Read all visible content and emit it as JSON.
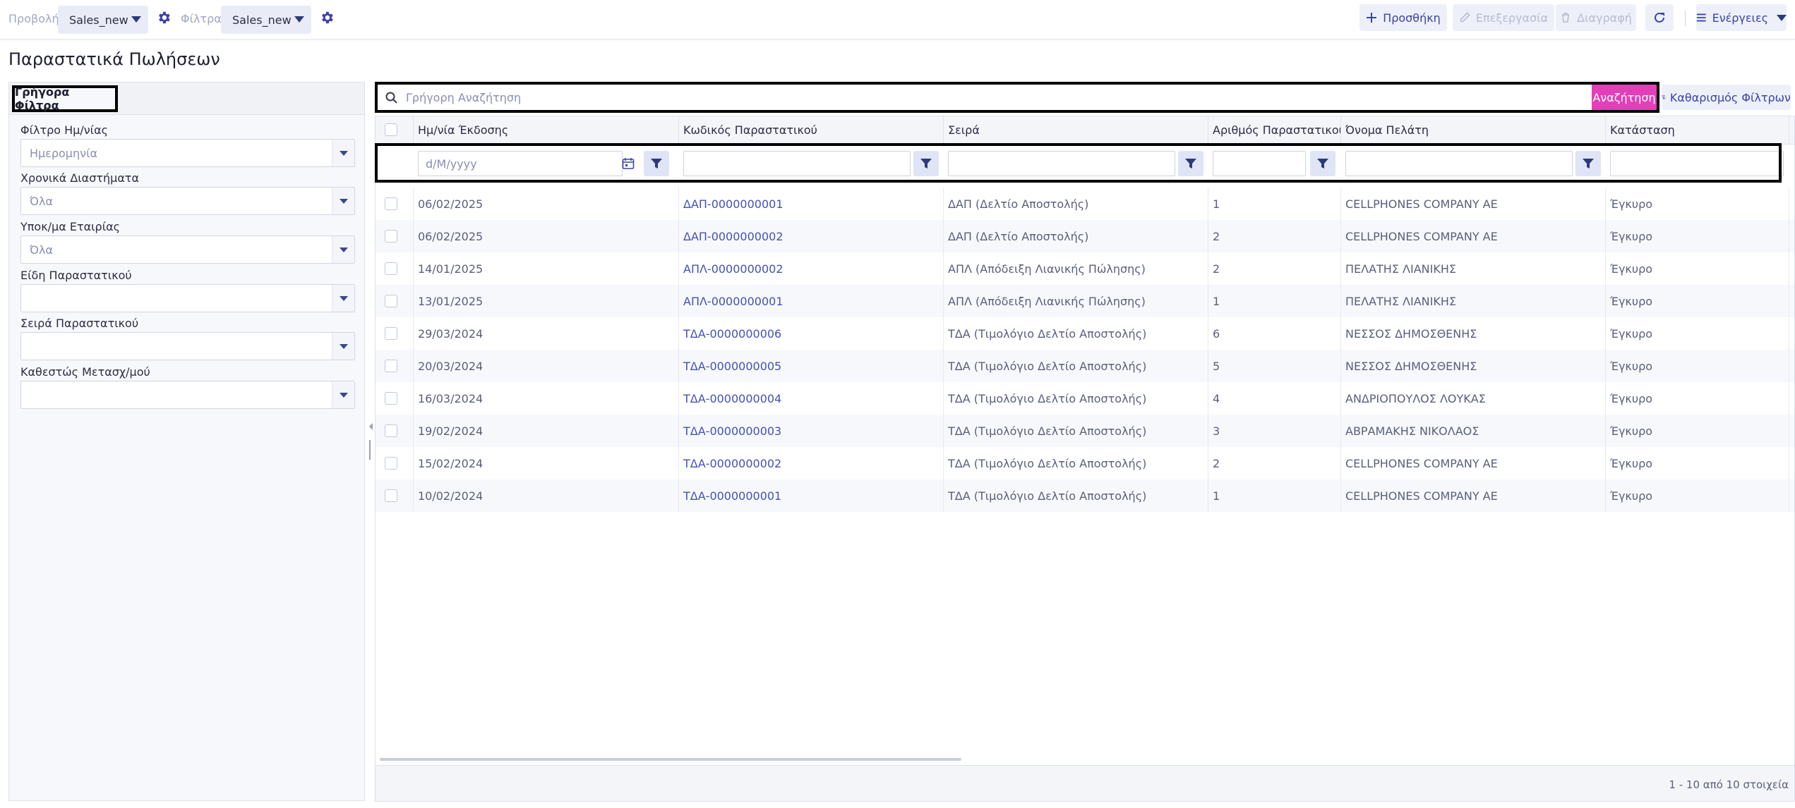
{
  "toolbar": {
    "view_label": "Προβολή",
    "view_value": "Sales_new",
    "filters_label": "Φίλτρα",
    "filters_value": "Sales_new",
    "add_label": "Προσθήκη",
    "edit_label": "Επεξεργασία",
    "delete_label": "Διαγραφή",
    "actions_label": "Ενέργειες"
  },
  "page": {
    "title": "Παραστατικά Πωλήσεων"
  },
  "quick_filters": {
    "tab_label": "Γρήγορα Φίλτρα",
    "fields": [
      {
        "label": "Φίλτρο Ημ/νίας",
        "value": "Ημερομηνία"
      },
      {
        "label": "Χρονικά Διαστήματα",
        "value": "Όλα"
      },
      {
        "label": "Υποκ/μα Εταιρίας",
        "value": "Όλα"
      },
      {
        "label": "Είδη Παραστατικού",
        "value": ""
      },
      {
        "label": "Σειρά Παραστατικού",
        "value": ""
      },
      {
        "label": "Καθεστώς Μετασχ/μού",
        "value": ""
      }
    ]
  },
  "search": {
    "placeholder": "Γρήγορη Αναζήτηση",
    "button_label": "Αναζήτηση",
    "clear_filters_label": "Καθαρισμός Φίλτρων"
  },
  "grid": {
    "columns": [
      "Ημ/νία Έκδοσης",
      "Κωδικός Παραστατικού",
      "Σειρά",
      "Αριθμός Παραστατικού",
      "Όνομα Πελάτη",
      "Κατάσταση"
    ],
    "date_placeholder": "d/M/yyyy",
    "rows": [
      [
        "06/02/2025",
        "ΔΑΠ-0000000001",
        "ΔΑΠ (Δελτίο Αποστολής)",
        "1",
        "CELLPHONES COMPANY AE",
        "Έγκυρο"
      ],
      [
        "06/02/2025",
        "ΔΑΠ-0000000002",
        "ΔΑΠ (Δελτίο Αποστολής)",
        "2",
        "CELLPHONES COMPANY AE",
        "Έγκυρο"
      ],
      [
        "14/01/2025",
        "ΑΠΛ-0000000002",
        "ΑΠΛ (Απόδειξη Λιανικής Πώλησης)",
        "2",
        "ΠΕΛΑΤΗΣ ΛΙΑΝΙΚΗΣ",
        "Έγκυρο"
      ],
      [
        "13/01/2025",
        "ΑΠΛ-0000000001",
        "ΑΠΛ (Απόδειξη Λιανικής Πώλησης)",
        "1",
        "ΠΕΛΑΤΗΣ ΛΙΑΝΙΚΗΣ",
        "Έγκυρο"
      ],
      [
        "29/03/2024",
        "ΤΔΑ-0000000006",
        "ΤΔΑ (Τιμολόγιο Δελτίο Αποστολής)",
        "6",
        "ΝΕΣΣΟΣ ΔΗΜΟΣΘΕΝΗΣ",
        "Έγκυρο"
      ],
      [
        "20/03/2024",
        "ΤΔΑ-0000000005",
        "ΤΔΑ (Τιμολόγιο Δελτίο Αποστολής)",
        "5",
        "ΝΕΣΣΟΣ ΔΗΜΟΣΘΕΝΗΣ",
        "Έγκυρο"
      ],
      [
        "16/03/2024",
        "ΤΔΑ-0000000004",
        "ΤΔΑ (Τιμολόγιο Δελτίο Αποστολής)",
        "4",
        "ΑΝΔΡΙΟΠΟΥΛΟΣ ΛΟΥΚΑΣ",
        "Έγκυρο"
      ],
      [
        "19/02/2024",
        "ΤΔΑ-0000000003",
        "ΤΔΑ (Τιμολόγιο Δελτίο Αποστολής)",
        "3",
        "ΑΒΡΑΜΑΚΗΣ ΝΙΚΟΛΑΟΣ",
        "Έγκυρο"
      ],
      [
        "15/02/2024",
        "ΤΔΑ-0000000002",
        "ΤΔΑ (Τιμολόγιο Δελτίο Αποστολής)",
        "2",
        "CELLPHONES COMPANY AE",
        "Έγκυρο"
      ],
      [
        "10/02/2024",
        "ΤΔΑ-0000000001",
        "ΤΔΑ (Τιμολόγιο Δελτίο Αποστολής)",
        "1",
        "CELLPHONES COMPANY AE",
        "Έγκυρο"
      ]
    ],
    "footer_info": "1 - 10 από 10 στοιχεία"
  },
  "colors": {
    "accent": "#3a43a8",
    "search_button": "#e23fb9",
    "link": "#4451b5"
  },
  "icons": [
    "gear-icon",
    "plus-icon",
    "pencil-icon",
    "trash-icon",
    "refresh-icon",
    "menu-icon",
    "search-icon",
    "filter-clear-icon",
    "calendar-icon",
    "filter-icon"
  ]
}
